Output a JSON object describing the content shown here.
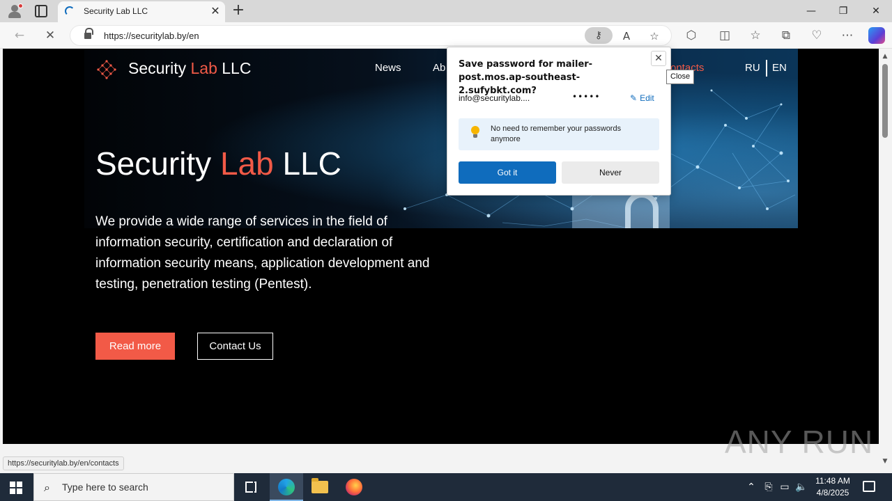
{
  "browser": {
    "tab_title": "Security Lab LLC",
    "url": "https://securitylab.by/en",
    "status_url": "https://securitylab.by/en/contacts"
  },
  "site": {
    "logo": {
      "part1": "Security ",
      "part2": "Lab",
      "part3": " LLC"
    },
    "nav": [
      "News",
      "Ab",
      "ontacts"
    ],
    "lang": [
      "RU",
      "EN"
    ],
    "hero": {
      "title_part1": "Security ",
      "title_part2": "Lab",
      "title_part3": " LLC",
      "description": "We provide a wide range of services in the field of information security, certification and declaration of information security means, application development and testing, penetration testing (Pentest).",
      "read_more": "Read more",
      "contact_us": "Contact Us"
    },
    "accent_color": "#f25a47"
  },
  "password_popup": {
    "title": "Save password for mailer-post.mos.ap-southeast-2.sufybkt.com?",
    "username": "info@securitylab....",
    "password_mask": "•••••",
    "edit_label": "Edit",
    "tip": "No need to remember your passwords anymore",
    "got_it": "Got it",
    "never": "Never",
    "close_tooltip": "Close"
  },
  "watermark": "ANY RUN",
  "taskbar": {
    "search_placeholder": "Type here to search",
    "time": "11:48 AM",
    "date": "4/8/2025"
  }
}
